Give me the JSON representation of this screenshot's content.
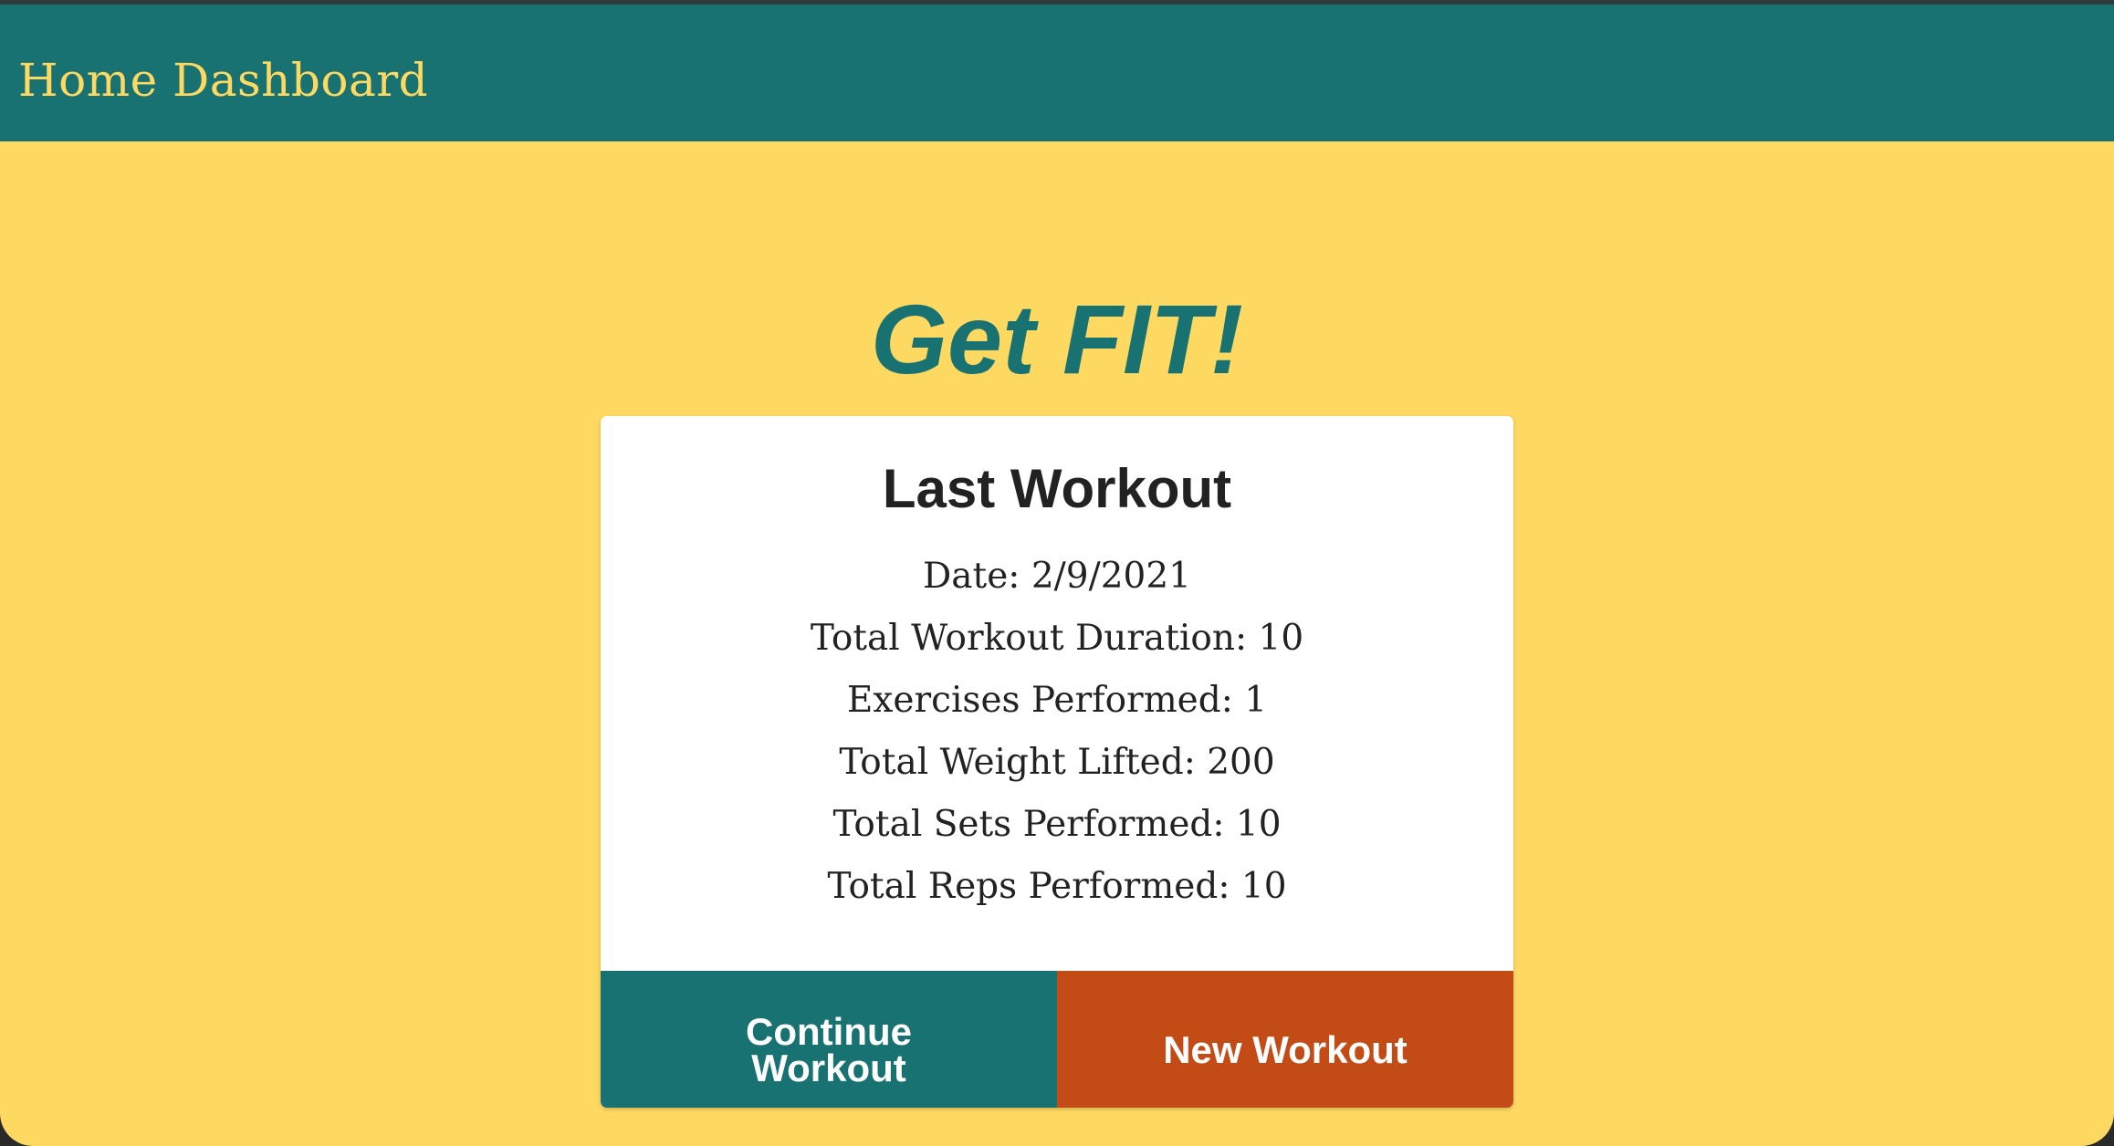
{
  "navbar": {
    "title": "Home Dashboard"
  },
  "hero": {
    "title": "Get FIT!"
  },
  "last_workout": {
    "heading": "Last Workout",
    "date_line": "Date: 2/9/2021",
    "duration_line": "Total Workout Duration: 10",
    "exercises_line": "Exercises Performed: 1",
    "weight_line": "Total Weight Lifted: 200",
    "sets_line": "Total Sets Performed: 10",
    "reps_line": "Total Reps Performed: 10"
  },
  "actions": {
    "continue_label": "Continue Workout",
    "new_label": "New Workout"
  },
  "colors": {
    "background": "#fed962",
    "navbar": "#197272",
    "accent_teal": "#197272",
    "accent_orange": "#c24b16",
    "card": "#ffffff",
    "text_dark": "#222222"
  }
}
